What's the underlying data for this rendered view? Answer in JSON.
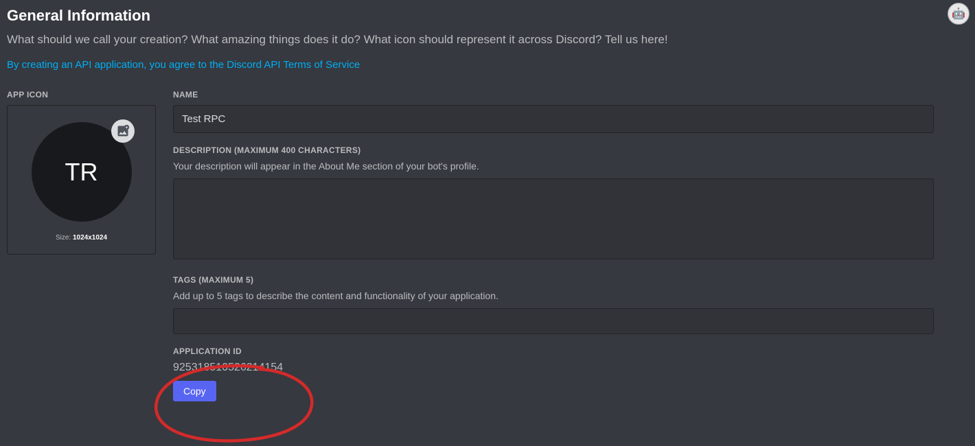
{
  "header": {
    "title": "General Information",
    "subtitle": "What should we call your creation? What amazing things does it do? What icon should represent it across Discord? Tell us here!",
    "tos_text": "By creating an API application, you agree to the Discord API Terms of Service"
  },
  "app_icon": {
    "label": "APP ICON",
    "initials": "TR",
    "size_prefix": "Size: ",
    "size_value": "1024x1024"
  },
  "name": {
    "label": "NAME",
    "value": "Test RPC"
  },
  "description": {
    "label": "DESCRIPTION (MAXIMUM 400 CHARACTERS)",
    "help": "Your description will appear in the About Me section of your bot's profile.",
    "value": ""
  },
  "tags": {
    "label": "TAGS (MAXIMUM 5)",
    "help": "Add up to 5 tags to describe the content and functionality of your application."
  },
  "application_id": {
    "label": "APPLICATION ID",
    "value": "925318510526214154",
    "copy_label": "Copy"
  },
  "colors": {
    "accent": "#5865f2",
    "link": "#00aff4",
    "bg": "#36393f",
    "input_bg": "#313339",
    "annotation": "#d42a2a"
  }
}
